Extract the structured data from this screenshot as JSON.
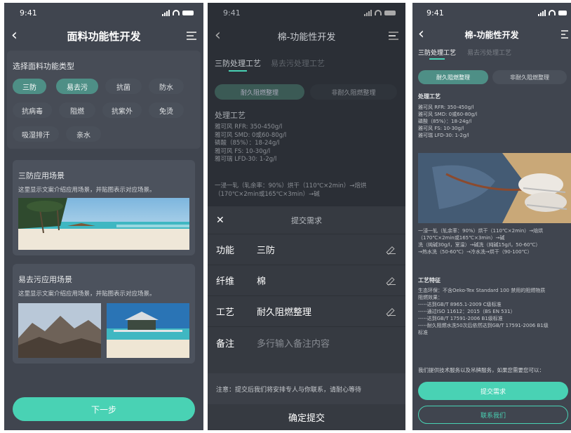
{
  "status": {
    "time": "9:41"
  },
  "screen1": {
    "title": "面料功能性开发",
    "section_label": "选择面料功能类型",
    "chips": [
      {
        "label": "三防",
        "selected": true
      },
      {
        "label": "易去污",
        "selected": true
      },
      {
        "label": "抗菌",
        "selected": false
      },
      {
        "label": "防水",
        "selected": false
      },
      {
        "label": "抗病毒",
        "selected": false
      },
      {
        "label": "阻燃",
        "selected": false
      },
      {
        "label": "抗紫外",
        "selected": false
      },
      {
        "label": "免烫",
        "selected": false
      },
      {
        "label": "吸湿排汗",
        "selected": false
      },
      {
        "label": "亲水",
        "selected": false
      }
    ],
    "card1": {
      "title": "三防应用场景",
      "desc": "这里显示文案介绍应用场景，并贴图表示对应场景。"
    },
    "card2": {
      "title": "易去污应用场景",
      "desc": "这里显示文案介绍应用场景，并贴图表示对应场景。"
    },
    "next_button": "下一步"
  },
  "screen2": {
    "title": "棉-功能性开发",
    "tabs": [
      "三防处理工艺",
      "易去污处理工艺"
    ],
    "segments": [
      "耐久阻燃整理",
      "非耐久阻燃整理"
    ],
    "process_title": "处理工艺",
    "process_text": "雅可风 RFR: 350-450g/l\n雅可风 SMD: 0或60-80g/l\n磷酸（85%）：18-24g/l\n雅可风 FS: 10-30g/l\n雅可瑞 LFD-30: 1-2g/l",
    "flow_text": "一浸一轧（轧余率：90%）烘干（110℃×2min）→焙烘\n（170℃×2min或165℃×3min）→碱",
    "sheet": {
      "title": "提交需求",
      "close": "✕",
      "rows": [
        {
          "label": "功能",
          "value": "三防",
          "placeholder": false
        },
        {
          "label": "纤维",
          "value": "棉",
          "placeholder": false
        },
        {
          "label": "工艺",
          "value": "耐久阻燃整理",
          "placeholder": false
        },
        {
          "label": "备注",
          "value": "多行输入备注内容",
          "placeholder": true
        }
      ],
      "notice": "注意：提交后我们将安排专人与你联系，请耐心等待",
      "confirm": "确定提交"
    }
  },
  "screen3": {
    "title": "棉-功能性开发",
    "tabs": [
      "三防处理工艺",
      "易去污处理工艺"
    ],
    "segments": [
      "耐久阻燃整理",
      "非耐久阻燃整理"
    ],
    "process_title": "处理工艺",
    "process_text": "雅可风 RFR: 350-450g/l\n雅可风 SMD: 0或60-80g/l\n磷酸（85%）：18-24g/l\n雅可风 FS: 10-30g/l\n雅可瑞 LFD-30: 1-2g/l",
    "flow_text": "一浸一轧（轧余率：90%）烘干（110℃×2min）→焙烘\n（170℃×2min或165℃×3min）→碱\n洗（纯碱30g/l，室温）→碱洗（纯碱15g/l，50-60℃）\n→热水洗（50-60℃）→冷水洗→烘干（90-100℃）",
    "feature_title": "工艺特征",
    "feature_text": "生态环保：不含Oeko-Tex Standard 100 禁用的阻燃物质\n阻燃效果：\n-----达到GB/T 8965.1-2009 C级标准\n-----通过ISO 11612：2015（BS EN 531）\n-----达到GB/T 17591-2006 B1级标准\n-----耐久阻燃水洗50次后依然达到GB/T 17591-2006 B1级\n标准",
    "service_text": "我们提供技术服务以及吊牌服务，如果您需要您可以：",
    "submit_button": "提交需求",
    "contact_button": "联系我们"
  }
}
